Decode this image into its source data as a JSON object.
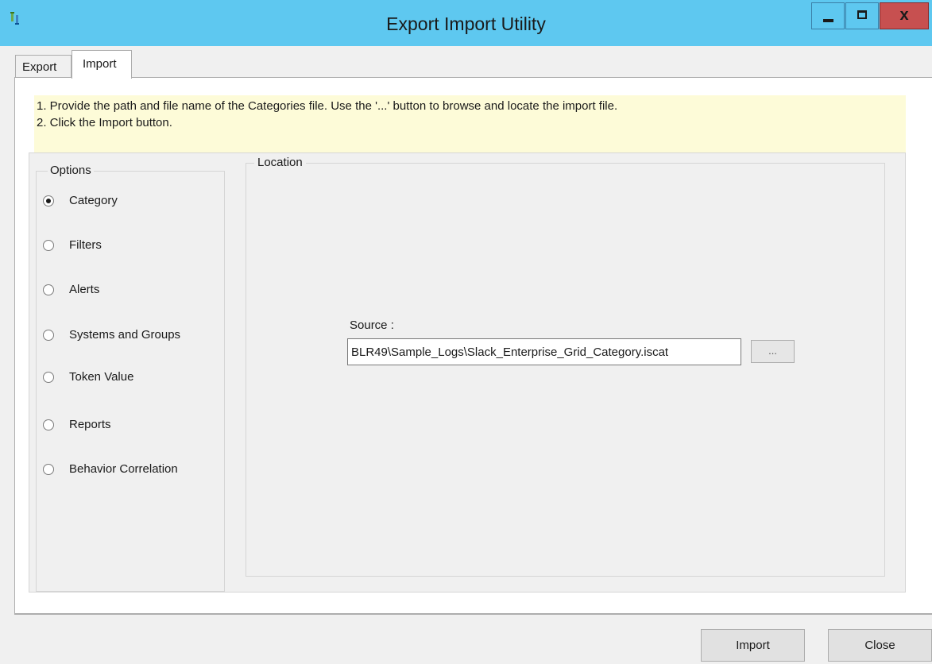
{
  "window": {
    "title": "Export Import Utility",
    "close_glyph": "x"
  },
  "tabs": {
    "export_label": "Export",
    "import_label": "Import",
    "active": "Import"
  },
  "instructions": {
    "line1": "1. Provide the path and file name of the Categories file. Use the '...' button to browse and locate the import file.",
    "line2": "2. Click the Import button."
  },
  "options": {
    "legend": "Options",
    "items": [
      {
        "label": "Category",
        "checked": true
      },
      {
        "label": "Filters",
        "checked": false
      },
      {
        "label": "Alerts",
        "checked": false
      },
      {
        "label": "Systems and Groups",
        "checked": false
      },
      {
        "label": "Token Value",
        "checked": false
      },
      {
        "label": "Reports",
        "checked": false
      },
      {
        "label": "Behavior Correlation",
        "checked": false
      }
    ]
  },
  "location": {
    "legend": "Location",
    "source_label": "Source :",
    "source_value": "BLR49\\Sample_Logs\\Slack_Enterprise_Grid_Category.iscat",
    "browse_label": "..."
  },
  "footer": {
    "import_label": "Import",
    "close_label": "Close"
  },
  "colors": {
    "titlebar": "#5ec8f0",
    "close_button": "#c75050",
    "instructions_bg": "#fdfbd8"
  },
  "icons": {
    "app": "app-icon",
    "minimize": "minimize-icon",
    "maximize": "maximize-icon",
    "close": "close-icon",
    "radio": "radio-button-icon"
  }
}
